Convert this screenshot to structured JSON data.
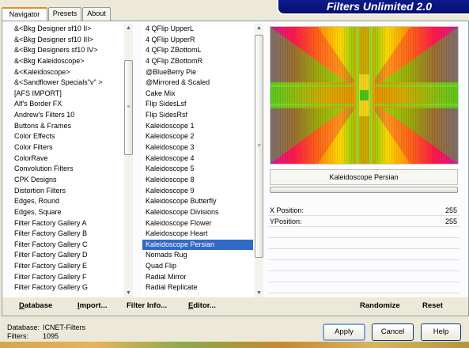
{
  "tabs": [
    {
      "label": "Navigator",
      "active": true
    },
    {
      "label": "Presets",
      "active": false
    },
    {
      "label": "About",
      "active": false
    }
  ],
  "title": "Filters Unlimited 2.0",
  "categories": {
    "items": [
      "&<Bkg Designer sf10 II>",
      "&<Bkg Designer sf10 III>",
      "&<Bkg Designers sf10 IV>",
      "&<Bkg Kaleidoscope>",
      "&<Kaleidoscope>",
      "&<Sandflower Specials\"v\" >",
      "[AFS IMPORT]",
      "Alf's Border FX",
      "Andrew's Filters 10",
      "Buttons & Frames",
      "Color Effects",
      "Color Filters",
      "ColorRave",
      "Convolution Filters",
      "CPK Designs",
      "Distortion Filters",
      "Edges, Round",
      "Edges, Square",
      "Filter Factory Gallery A",
      "Filter Factory Gallery B",
      "Filter Factory Gallery C",
      "Filter Factory Gallery D",
      "Filter Factory Gallery E",
      "Filter Factory Gallery F",
      "Filter Factory Gallery G"
    ]
  },
  "filters": {
    "selected_index": 20,
    "items": [
      "4 QFlip UpperL",
      "4 QFlip UpperR",
      "4 QFlip ZBottomL",
      "4 QFlip ZBottomR",
      "@BlueBerry Pie",
      "@Mirrored & Scaled",
      "Cake Mix",
      "Flip SidesLsf",
      "Flip SidesRsf",
      "Kaleidoscope 1",
      "Kaleidoscope 2",
      "Kaleidoscope 3",
      "Kaleidoscope 4",
      "Kaleidoscope 5",
      "Kaleidoscope 8",
      "Kaleidoscope 9",
      "Kaleidoscope Butterfly",
      "Kaleidoscope Divisions",
      "Kaleidoscope Flower",
      "Kaleidoscope Heart",
      "Kaleidoscope Persian",
      "Nomads Rug",
      "Quad Flip",
      "Radial Mirror",
      "Radial Replicate"
    ]
  },
  "preview": {
    "filter_name": "Kaleidoscope Persian"
  },
  "params": [
    {
      "label": "X Position:",
      "value": "255"
    },
    {
      "label": "YPosition:",
      "value": "255"
    }
  ],
  "toolbar": {
    "database": "Database",
    "import": "Import...",
    "filter_info": "Filter Info...",
    "editor": "Editor...",
    "randomize": "Randomize",
    "reset": "Reset"
  },
  "info": {
    "database_label": "Database:",
    "database_value": "ICNET-Filters",
    "filters_label": "Filters:",
    "filters_value": "1095"
  },
  "buttons": {
    "apply": "Apply",
    "cancel": "Cancel",
    "help": "Help"
  },
  "colors": {
    "selection": "#3169c6",
    "title_bg": "#0d1a8a",
    "tab_accent": "#e68b2c"
  }
}
